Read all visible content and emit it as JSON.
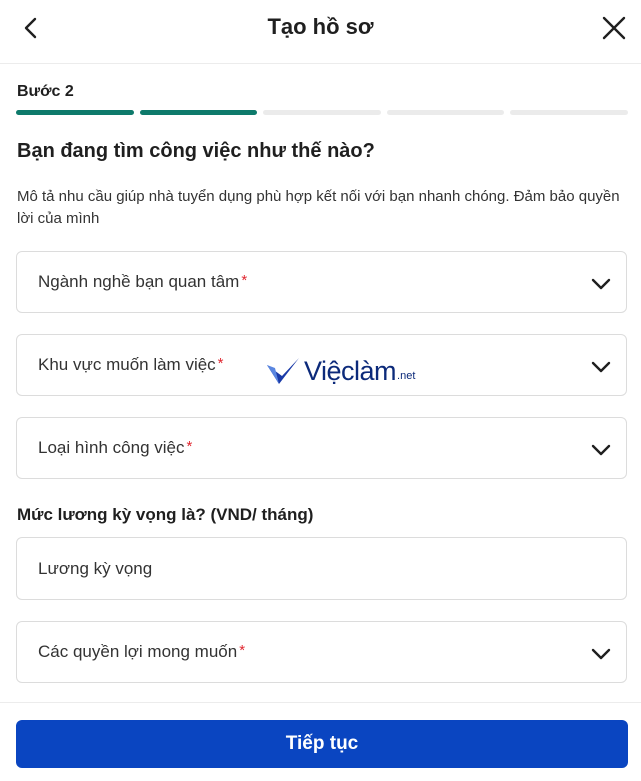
{
  "header": {
    "title": "Tạo hồ sơ"
  },
  "step": {
    "label": "Bước 2",
    "progress_segments": 5,
    "progress_completed": 2,
    "active_color": "#0e7a6b"
  },
  "question": "Bạn đang tìm công việc như thế nào?",
  "description": "Mô tả nhu cầu giúp nhà tuyển dụng phù hợp kết nối với bạn nhanh chóng. Đảm bảo quyền lời của mình",
  "fields": {
    "industry": {
      "label": "Ngành nghề bạn quan tâm",
      "required": "*"
    },
    "location": {
      "label": "Khu vực muốn làm việc",
      "required": "*"
    },
    "job_type": {
      "label": "Loại hình công việc",
      "required": "*"
    },
    "benefits": {
      "label": "Các quyền lợi mong muốn",
      "required": "*"
    }
  },
  "salary": {
    "heading": "Mức lương kỳ vọng là? (VND/ tháng)",
    "placeholder": "Lương kỳ vọng"
  },
  "watermark": {
    "text": "Việclàm",
    "suffix": ".net"
  },
  "footer": {
    "continue_label": "Tiếp tục",
    "button_color": "#0a45c1"
  }
}
